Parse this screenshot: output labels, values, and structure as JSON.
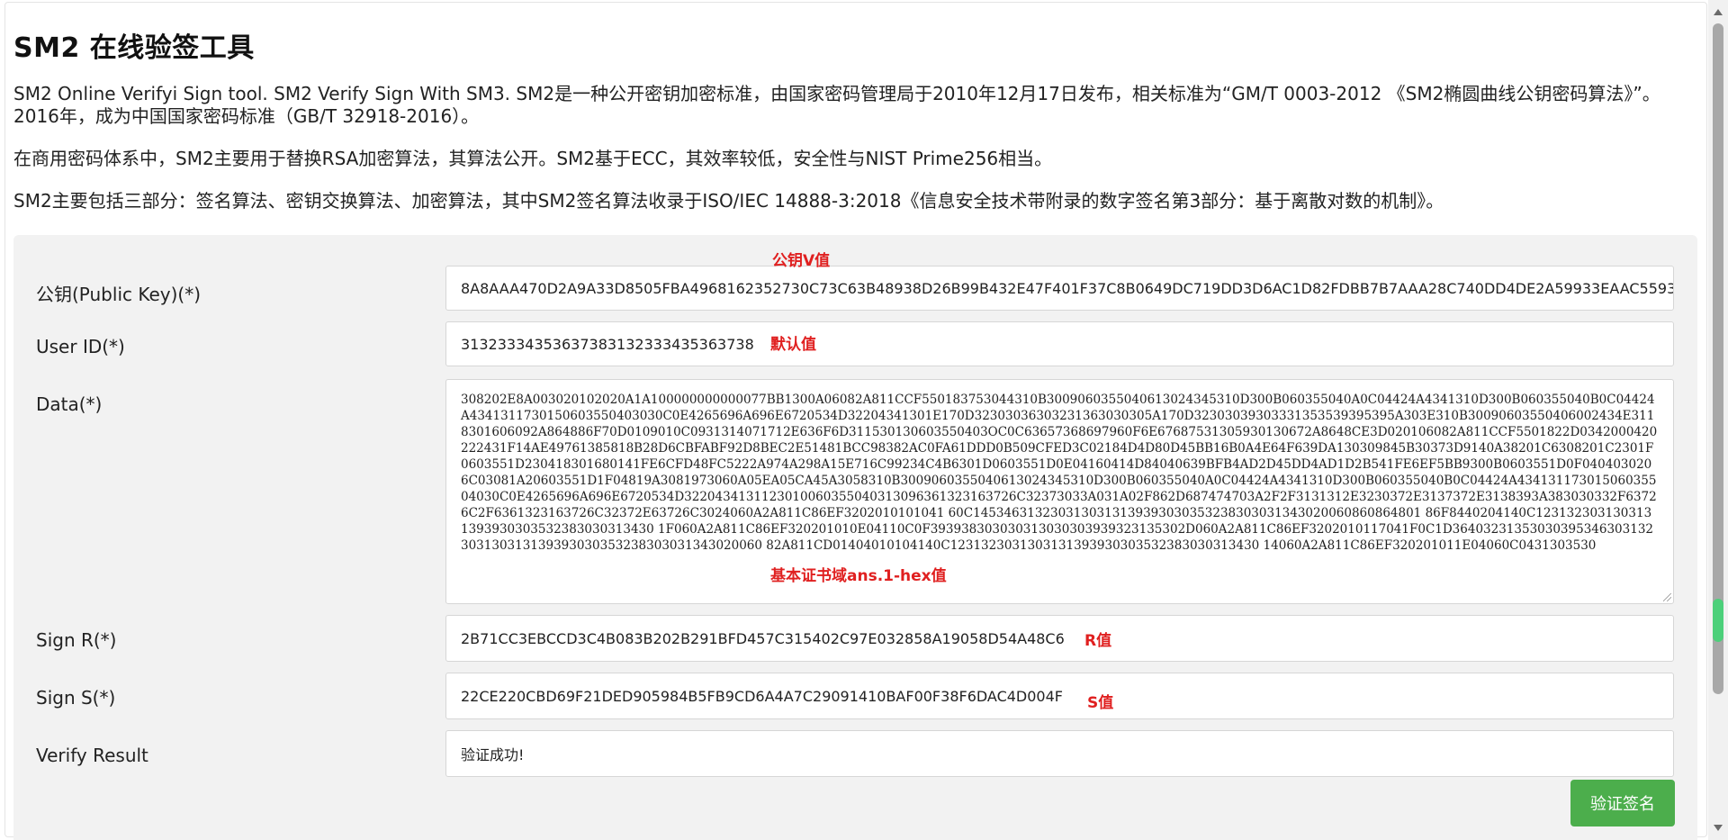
{
  "page": {
    "title": "SM2 在线验签工具",
    "descriptions": [
      "SM2 Online Verifyi Sign tool. SM2 Verify Sign With SM3. SM2是一种公开密钥加密标准，由国家密码管理局于2010年12月17日发布，相关标准为“GM/T 0003-2012 《SM2椭圆曲线公钥密码算法》”。2016年，成为中国国家密码标准（GB/T 32918-2016）。",
      "在商用密码体系中，SM2主要用于替换RSA加密算法，其算法公开。SM2基于ECC，其效率较低，安全性与NIST Prime256相当。",
      "SM2主要包括三部分：签名算法、密钥交换算法、加密算法，其中SM2签名算法收录于ISO/IEC 14888-3:2018《信息安全技术带附录的数字签名第3部分：基于离散对数的机制》。"
    ]
  },
  "form": {
    "public_key": {
      "label": "公钥(Public Key)(*)",
      "value": "8A8AAA470D2A9A33D8505FBA4968162352730C73C63B48938D26B99B432E47F401F37C8B0649DC719DD3D6AC1D82FDBB7B7AAA28C740DD4DE2A59933EAAC5593"
    },
    "user_id": {
      "label": "User ID(*)",
      "value": "31323334353637383132333435363738"
    },
    "data": {
      "label": "Data(*)",
      "value": "308202E8A003020102020A1A100000000000077BB1300A06082A811CCF550183753044310B3009060355040613024345310D300B060355040A0C04424A4341310D300B060355040B0C04424A4341311730150603550403030C0E4265696A696E6720534D32204341301E170D32303036303231363030305A170D32303039303331353539395395A303E310B30090603550406002434E3118301606092A864886F70D0109010C0931314071712E636F6D311530130603550403OC0C63657368697960F6E67687531305930130672A8648CE3D020106082A811CCF5501822D0342000420222431F14AE49761385818B28D6CBFABF92D8BEC2E51481BCC98382AC0FA61DDD0B509CFED3C02184D4D80D45BB16B0A4E64F639DA130309845B30373D9140A38201C6308201C2301F0603551D230418301680141FE6CFD48FC5222A974A298A15E716C99234C4B6301D0603551D0E04160414D84040639BFB4AD2D45DD4AD1D2B541FE6EF5BB9300B0603551D0F0404030206C03081A20603551D1F04819A3081973060A05EA05CA45A3058310B3009060355040613024345310D300B060355040A0C04424A4341310D300B060355040B0C04424A43413117301506035504030C0E4265696A696E6720534D3220434131123010060355040313096361323163726C32373033A031A02F862D687474703A2F2F3131312E3230372E3137372E3138393A383030332F63726C2F6361323163726C32372E63726C3024060A2A811C86EF3202010101041 60C1453463132303130313139393030353238303031343020060860864801 86F8440204140C1231323031303131393930303532383030313430 1F060A2A811C86EF320201010E04110C0F393938303030313030303939323135302D060A2A811C86EF3202010117041F0C1D36403231353030395346303132303130313139393030353238303031343020060 82A811CD01404010104140C1231323031303131393930303532383030313430 14060A2A811C86EF320201011E04060C0431303530"
    },
    "sign_r": {
      "label": "Sign R(*)",
      "value": "2B71CC3EBCCD3C4B083B202B291BFD457C315402C97E032858A19058D54A48C6"
    },
    "sign_s": {
      "label": "Sign S(*)",
      "value": "22CE220CBD69F21DED905984B5FB9CD6A4A7C29091410BAF00F38F6DAC4D004F"
    },
    "verify_result": {
      "label": "Verify Result",
      "value": "验证成功!"
    },
    "submit_label": "验证签名"
  },
  "annotations": {
    "public_key_note": "公钥V值",
    "user_id_note": "默认值",
    "data_note": "基本证书域ans.1-hex值",
    "r_note": "R值",
    "s_note": "S值"
  },
  "colors": {
    "panel_bg": "#f2f2f2",
    "button_green": "#4cae4c",
    "annotation_red": "#e02020"
  }
}
